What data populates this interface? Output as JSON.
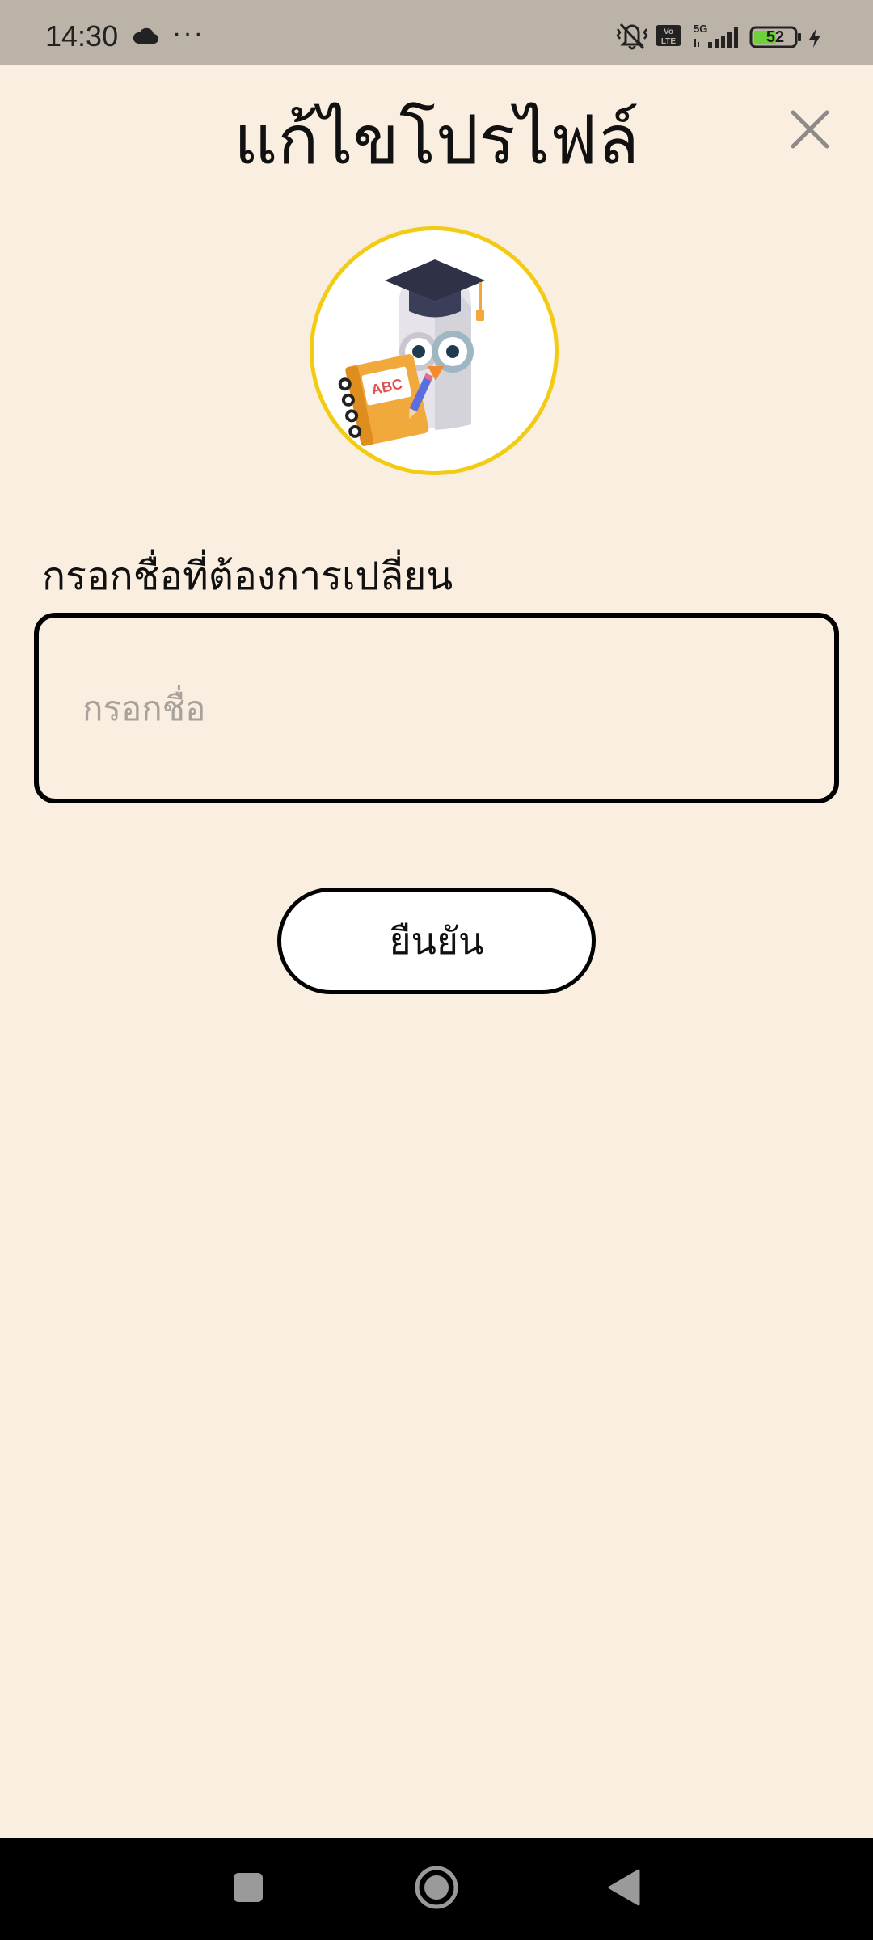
{
  "status_bar": {
    "time": "14:30",
    "more": "···",
    "battery": "52",
    "icons": [
      "cloud-icon",
      "mute-vibrate-icon",
      "volte-icon",
      "signal-5g-icon",
      "battery-icon",
      "charging-icon"
    ]
  },
  "header": {
    "title": "แก้ไขโปรไฟล์",
    "close_icon": "close-icon"
  },
  "avatar": {
    "icon": "owl-graduate-avatar",
    "book_text": "ABC"
  },
  "form": {
    "label": "กรอกชื่อที่ต้องการเปลี่ยน",
    "input_placeholder": "กรอกชื่อ",
    "input_value": "",
    "confirm_label": "ยืนยัน"
  },
  "nav_bar": {
    "items": [
      "recents-square-icon",
      "home-circle-icon",
      "back-triangle-icon"
    ]
  },
  "colors": {
    "background": "#f9eee0",
    "status_bar": "#bcb3a8",
    "avatar_border": "#f2cb12",
    "battery_fill": "#6fd13a"
  }
}
